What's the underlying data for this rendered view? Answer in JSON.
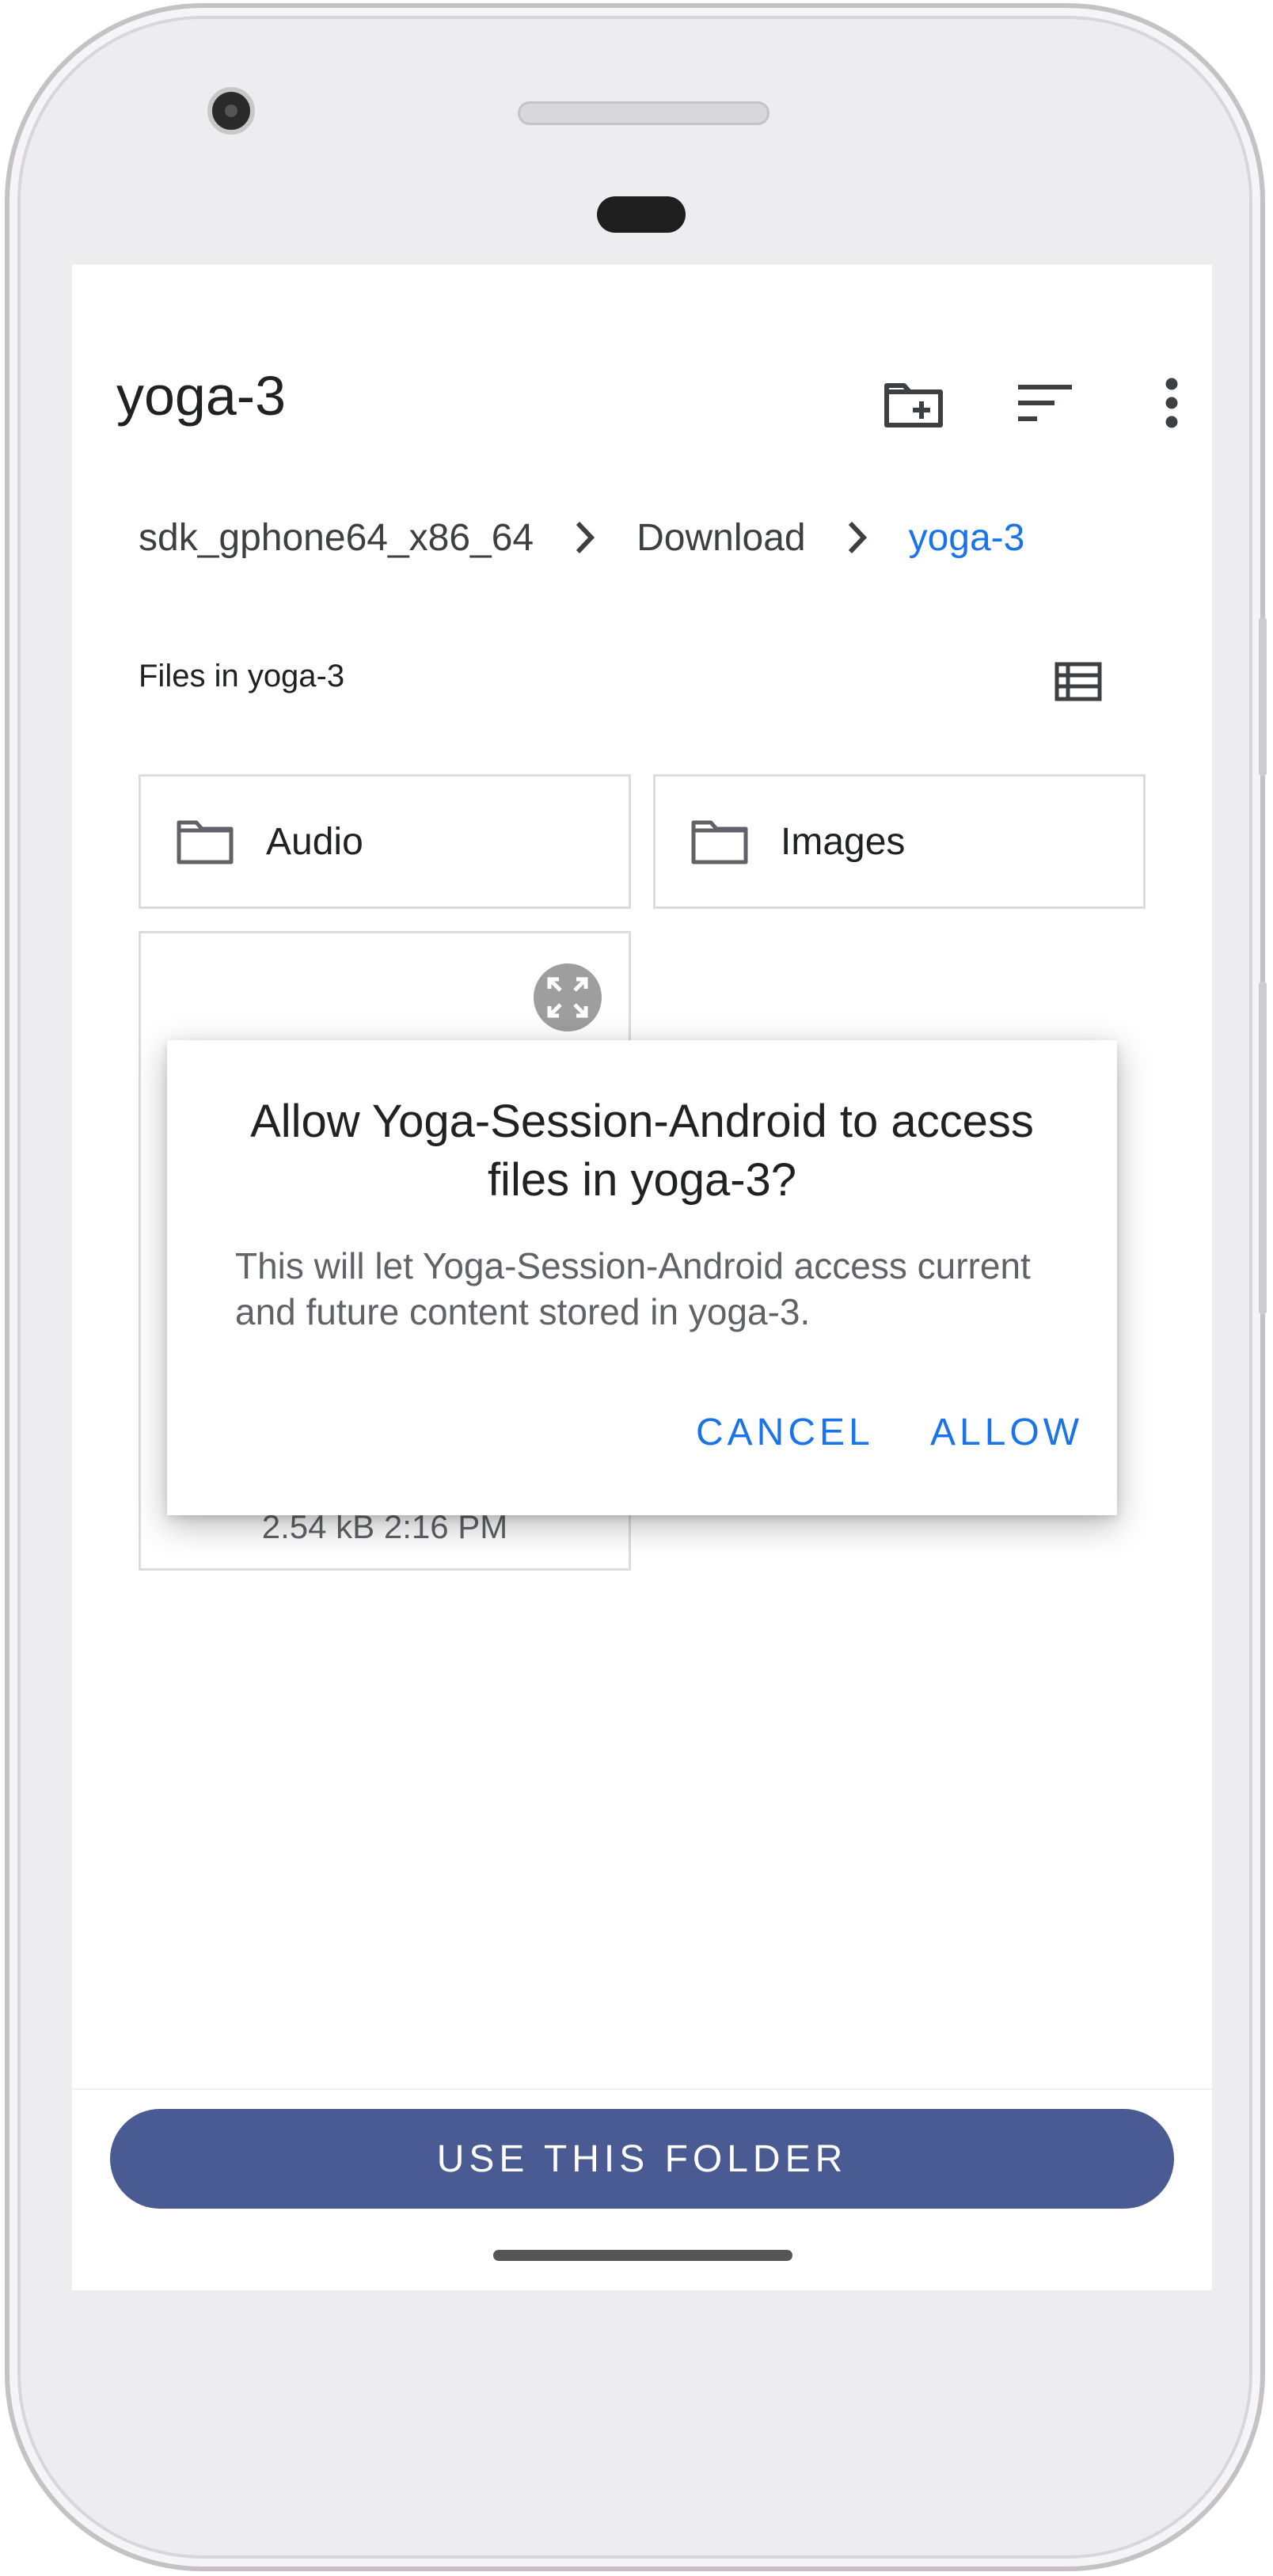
{
  "toolbar": {
    "title": "yoga-3",
    "icons": [
      "create-folder-icon",
      "sort-icon",
      "more-vert-icon"
    ]
  },
  "breadcrumb": {
    "items": [
      "sdk_gphone64_x86_64",
      "Download",
      "yoga-3"
    ],
    "separator_icon": "chevron-right-icon"
  },
  "files": {
    "section_label": "Files in yoga-3",
    "view_toggle_icon": "list-view-icon",
    "folders": [
      {
        "name": "Audio",
        "icon": "folder-icon"
      },
      {
        "name": "Images",
        "icon": "folder-icon"
      }
    ],
    "file": {
      "meta": "2.54 kB 2:16 PM",
      "expand_icon": "expand-icon"
    }
  },
  "dialog": {
    "title": "Allow Yoga-Session-Android to access files in yoga-3?",
    "body": "This will let Yoga-Session-Android access current and future content stored in yoga-3.",
    "cancel_label": "CANCEL",
    "allow_label": "ALLOW"
  },
  "bottom": {
    "use_folder_label": "USE THIS FOLDER"
  },
  "colors": {
    "accent": "#1a73e8",
    "primary_button": "#4a5b94"
  }
}
